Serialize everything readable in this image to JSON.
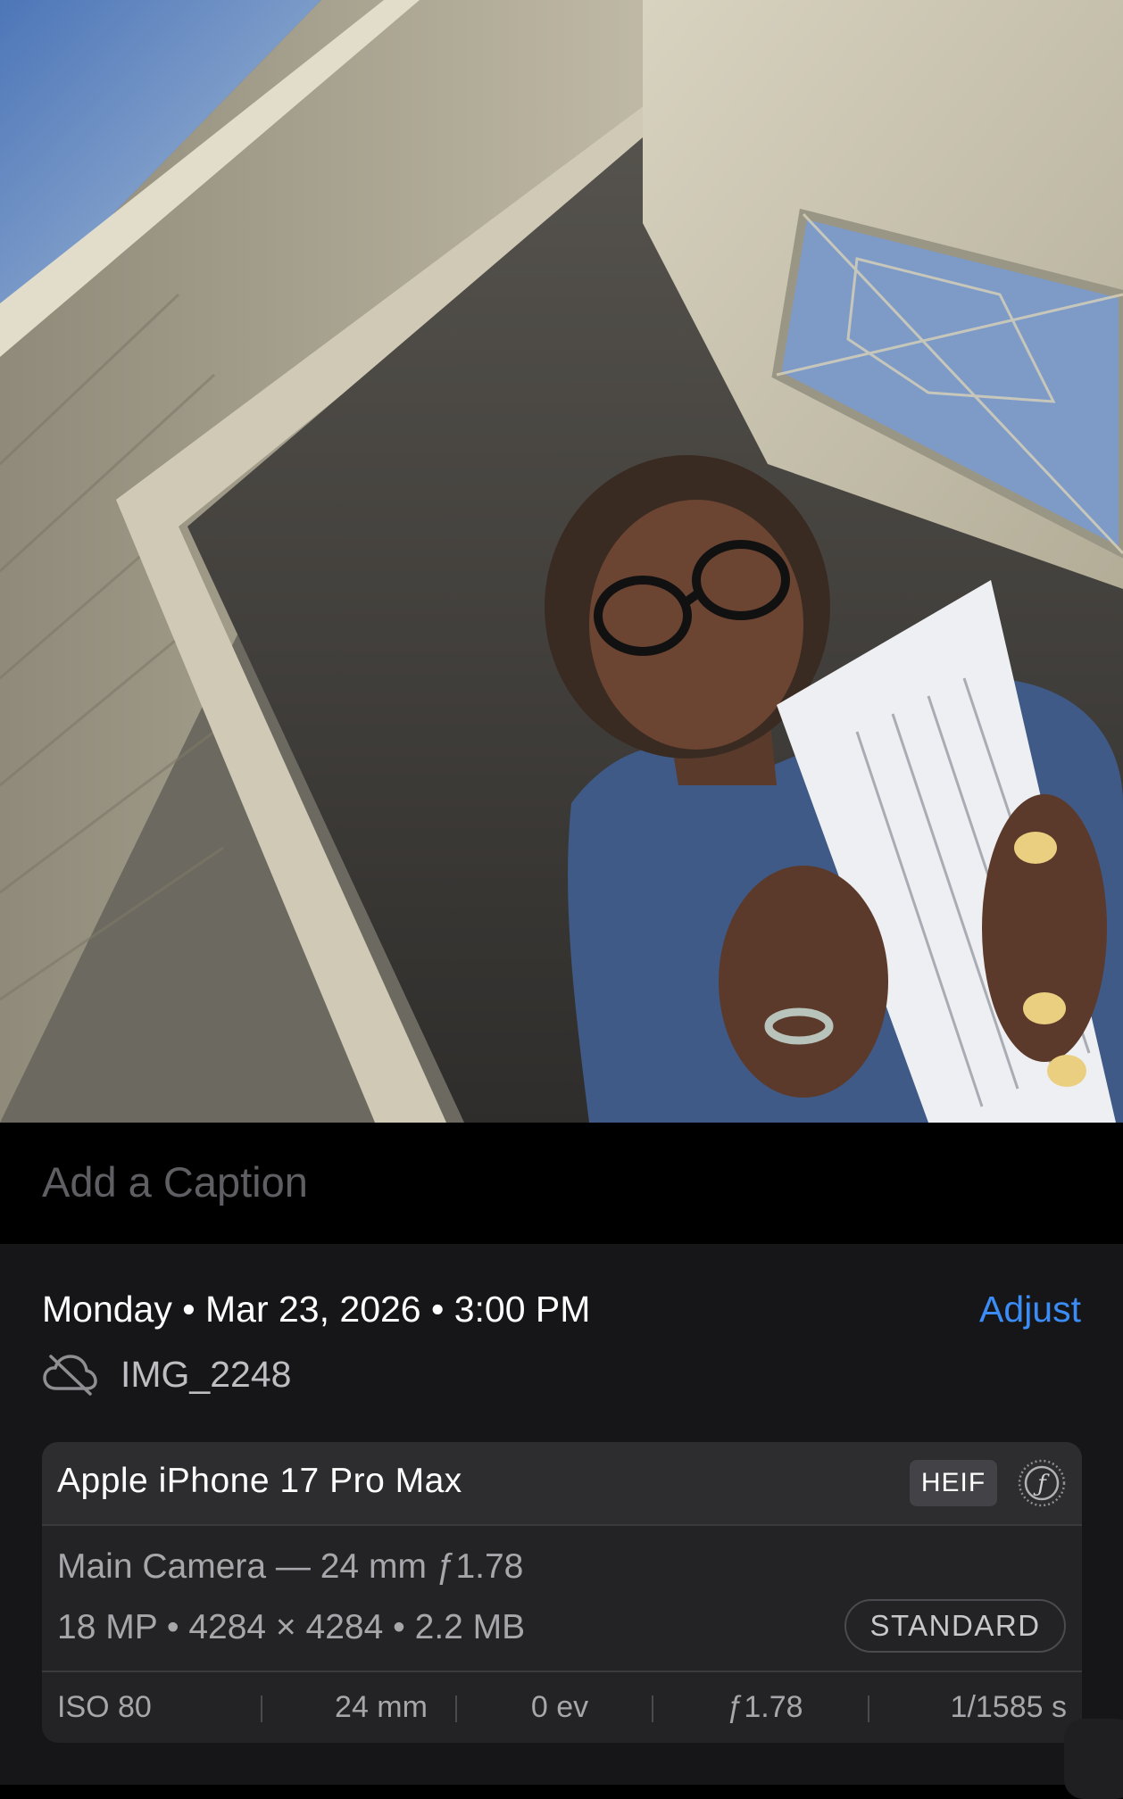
{
  "photo": {
    "description_icon": "photo-image"
  },
  "caption": {
    "placeholder": "Add a Caption"
  },
  "info": {
    "date_line": "Monday • Mar 23, 2026 • 3:00 PM",
    "adjust_label": "Adjust",
    "cloud_icon": "cloud-slash-icon",
    "file_name": "IMG_2248"
  },
  "metadata": {
    "device": "Apple iPhone 17 Pro Max",
    "format_badge": "HEIF",
    "f_icon": "f-stop-icon",
    "lens": "Main Camera — 24 mm ƒ1.78",
    "resolution": "18 MP • 4284 × 4284 • 2.2 MB",
    "standard_badge": "STANDARD",
    "exif": [
      "ISO 80",
      "24 mm",
      "0 ev",
      "ƒ1.78",
      "1/1585 s"
    ]
  },
  "colors": {
    "accent": "#3b8cf5",
    "panel": "#161618",
    "card": "#232326"
  }
}
